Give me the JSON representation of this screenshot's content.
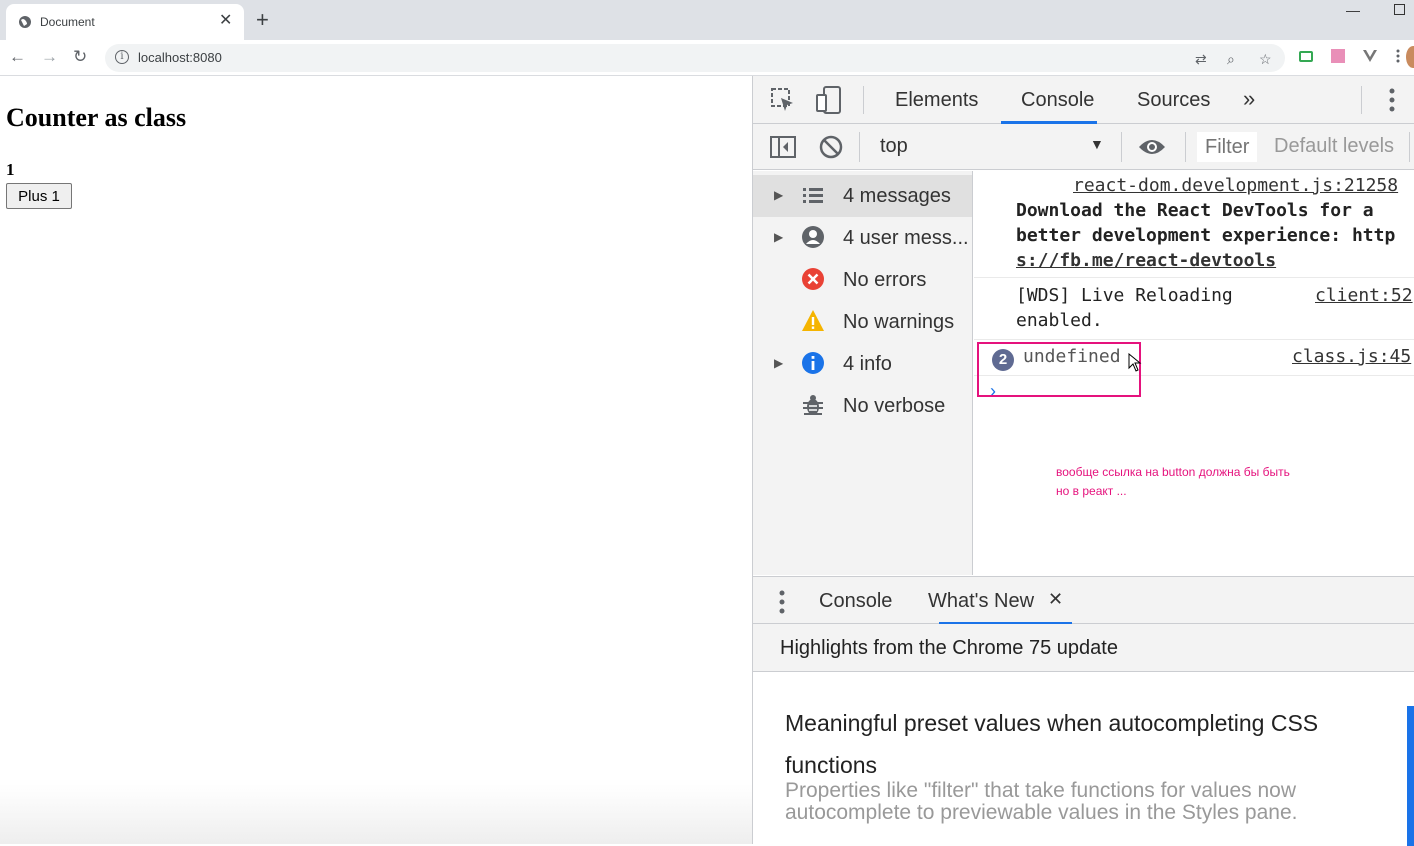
{
  "browser": {
    "tab_title": "Document",
    "url": "localhost:8080"
  },
  "page": {
    "heading": "Counter as class",
    "counter_value": "1",
    "button_label": "Plus 1"
  },
  "devtools": {
    "tabs": [
      "Elements",
      "Console",
      "Sources"
    ],
    "active_tab": "Console",
    "more_tabs_glyph": "»",
    "context": "top",
    "filter_placeholder": "Filter",
    "levels": "Default levels",
    "sidebar": [
      {
        "label": "4 messages",
        "icon": "list-icon",
        "expandable": true,
        "selected": true
      },
      {
        "label": "4 user mess...",
        "icon": "user-icon",
        "expandable": true,
        "selected": false
      },
      {
        "label": "No errors",
        "icon": "error-icon",
        "expandable": false,
        "selected": false
      },
      {
        "label": "No warnings",
        "icon": "warning-icon",
        "expandable": false,
        "selected": false
      },
      {
        "label": "4 info",
        "icon": "info-icon",
        "expandable": true,
        "selected": false
      },
      {
        "label": "No verbose",
        "icon": "bug-icon",
        "expandable": false,
        "selected": false
      }
    ],
    "messages": [
      {
        "source": "react-dom.development.js:21258",
        "lines": [
          "Download the React DevTools for a",
          "better development experience: http",
          "s://fb.me/react-devtools"
        ]
      },
      {
        "source": "client:52",
        "lines": [
          "[WDS] Live Reloading",
          "enabled."
        ]
      },
      {
        "source": "class.js:45",
        "count": "2",
        "text": "undefined"
      }
    ],
    "annotation": [
      "вообще ссылка на button должна бы быть",
      "но в реакт ..."
    ],
    "drawer": {
      "tabs": [
        "Console",
        "What's New"
      ],
      "active_tab": "What's New",
      "close_glyph": "✕",
      "subtitle": "Highlights from the Chrome 75 update",
      "heading": "Meaningful preset values when autocompleting CSS functions",
      "body": "Properties like \"filter\" that take functions for values now autocomplete to previewable values in the Styles pane."
    }
  },
  "colors": {
    "accent": "#1a73e8",
    "highlight": "#e5127d",
    "error": "#e94235",
    "warning": "#f5b400",
    "info": "#1a73e8"
  }
}
